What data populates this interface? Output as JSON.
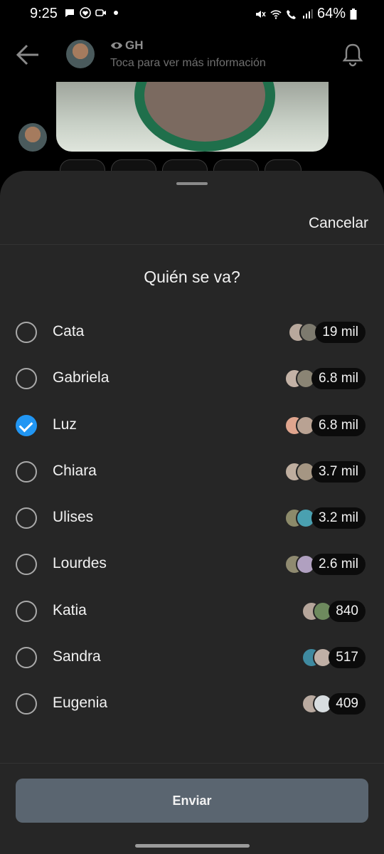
{
  "status_bar": {
    "time": "9:25",
    "battery": "64%"
  },
  "header": {
    "title": "GH",
    "subtitle": "Toca para ver más información"
  },
  "sheet": {
    "cancel_label": "Cancelar",
    "question": "Quién se va?",
    "options": [
      {
        "label": "Cata",
        "count": "19 mil",
        "selected": false
      },
      {
        "label": "Gabriela",
        "count": "6.8 mil",
        "selected": false
      },
      {
        "label": "Luz",
        "count": "6.8 mil",
        "selected": true
      },
      {
        "label": "Chiara",
        "count": "3.7 mil",
        "selected": false
      },
      {
        "label": "Ulises",
        "count": "3.2 mil",
        "selected": false
      },
      {
        "label": "Lourdes",
        "count": "2.6 mil",
        "selected": false
      },
      {
        "label": "Katia",
        "count": "840",
        "selected": false
      },
      {
        "label": "Sandra",
        "count": "517",
        "selected": false
      },
      {
        "label": "Eugenia",
        "count": "409",
        "selected": false
      }
    ],
    "submit_label": "Enviar"
  },
  "colors": {
    "accent": "#2196f3",
    "sheet_bg": "#262626",
    "button_bg": "#5a6570"
  }
}
